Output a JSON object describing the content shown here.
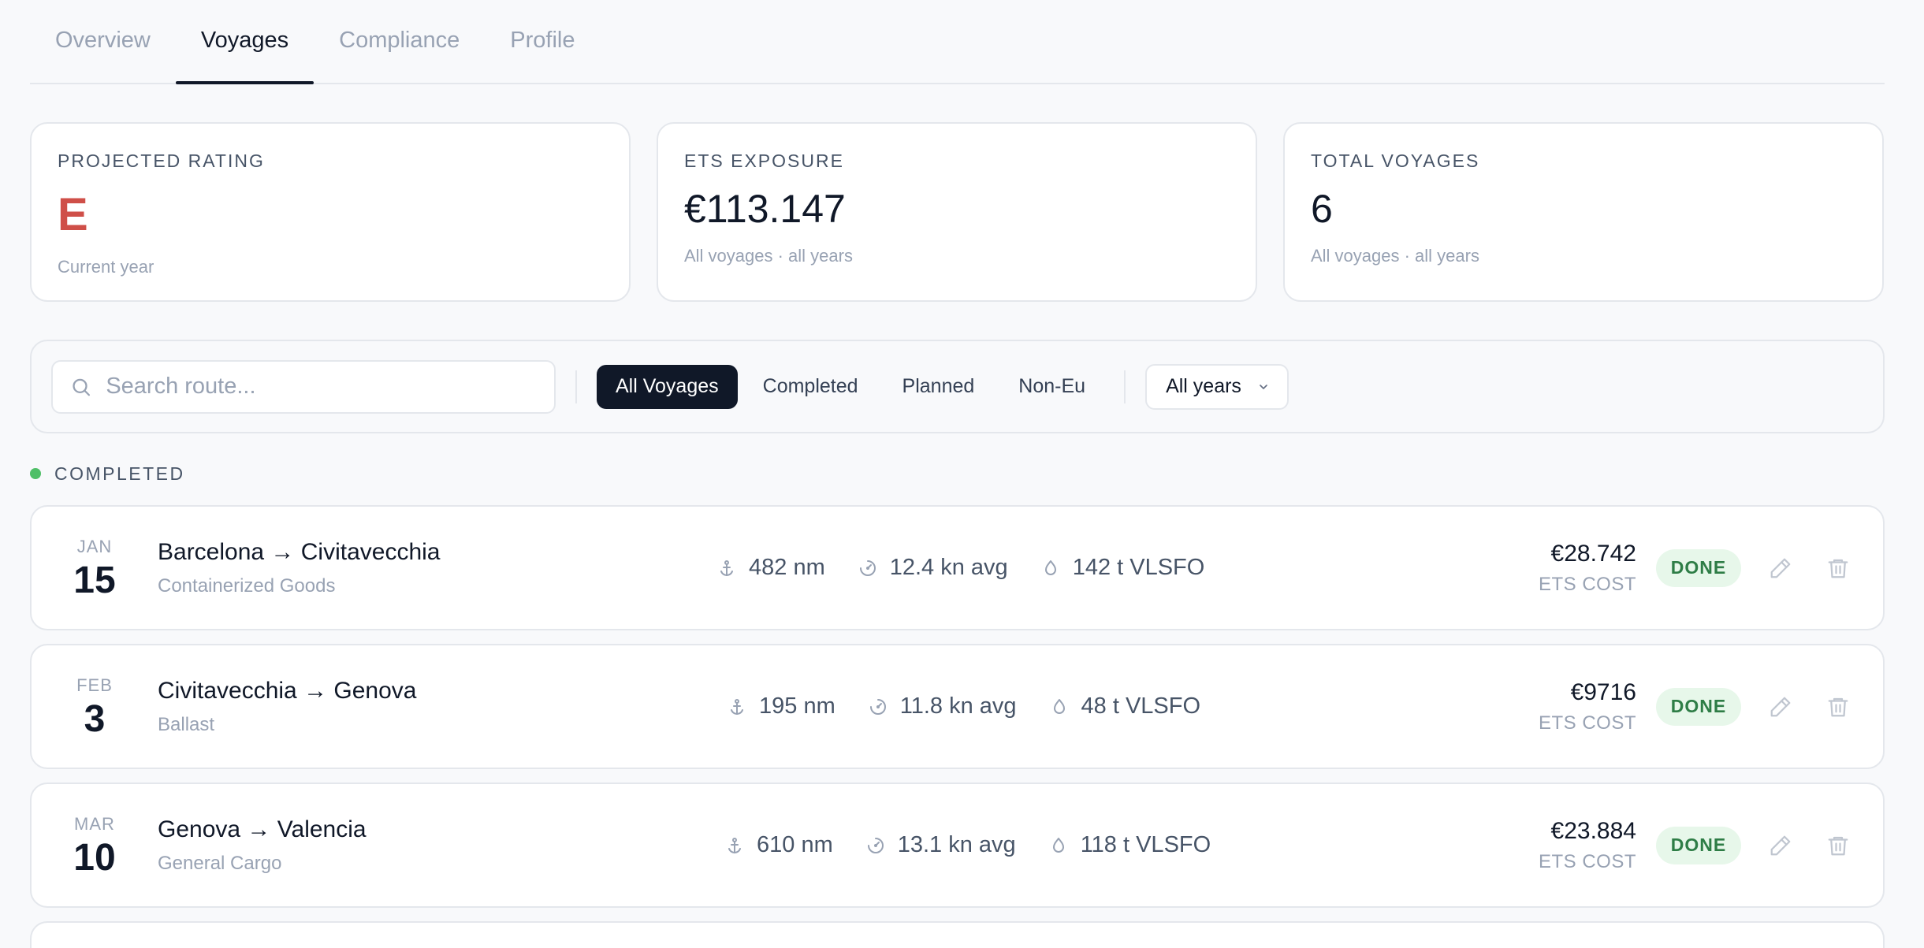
{
  "tabs": [
    {
      "label": "Overview",
      "active": false
    },
    {
      "label": "Voyages",
      "active": true
    },
    {
      "label": "Compliance",
      "active": false
    },
    {
      "label": "Profile",
      "active": false
    }
  ],
  "stats": {
    "rating": {
      "label": "PROJECTED RATING",
      "value": "E",
      "sub": "Current year",
      "color": "#cf4f48"
    },
    "ets": {
      "label": "ETS EXPOSURE",
      "value": "€113.147",
      "sub": "All voyages · all years"
    },
    "total": {
      "label": "TOTAL VOYAGES",
      "value": "6",
      "sub": "All voyages · all years"
    }
  },
  "filters": {
    "search_placeholder": "Search route...",
    "chips": [
      "All Voyages",
      "Completed",
      "Planned",
      "Non-Eu"
    ],
    "active_chip": "All Voyages",
    "year_select": "All years"
  },
  "section": {
    "label": "COMPLETED",
    "dot_color": "#4fbf67"
  },
  "voyages": [
    {
      "month": "JAN",
      "day": "15",
      "route": "Barcelona → Civitavecchia",
      "cargo": "Containerized Goods",
      "distance": "482 nm",
      "speed": "12.4 kn avg",
      "fuel": "142 t VLSFO",
      "cost": "€28.742",
      "cost_label": "ETS COST",
      "status": "DONE"
    },
    {
      "month": "FEB",
      "day": "3",
      "route": "Civitavecchia → Genova",
      "cargo": "Ballast",
      "distance": "195 nm",
      "speed": "11.8 kn avg",
      "fuel": "48 t VLSFO",
      "cost": "€9716",
      "cost_label": "ETS COST",
      "status": "DONE"
    },
    {
      "month": "MAR",
      "day": "10",
      "route": "Genova → Valencia",
      "cargo": "General Cargo",
      "distance": "610 nm",
      "speed": "13.1 kn avg",
      "fuel": "118 t VLSFO",
      "cost": "€23.884",
      "cost_label": "ETS COST",
      "status": "DONE"
    }
  ],
  "icons": {
    "search": "search-icon",
    "distance": "anchor-icon",
    "speed": "gauge-icon",
    "fuel": "droplet-icon",
    "edit": "pencil-icon",
    "delete": "trash-icon",
    "chevron": "chevron-down-icon"
  }
}
